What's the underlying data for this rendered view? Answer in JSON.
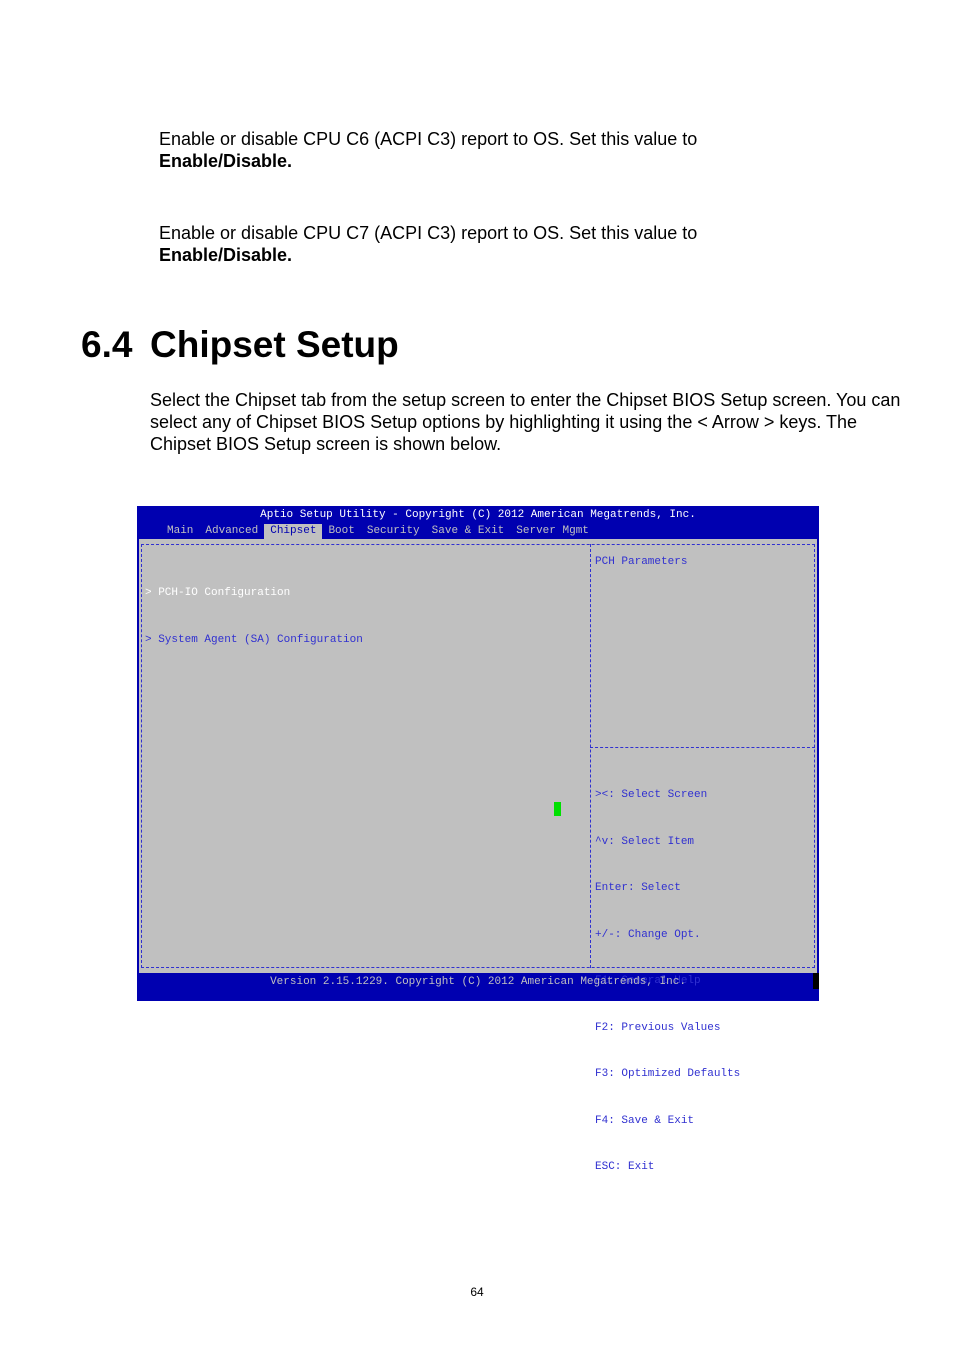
{
  "document": {
    "paragraph_c6": {
      "text": "Enable or disable CPU C6 (ACPI C3) report to OS. Set this value to",
      "bold": "Enable/Disable."
    },
    "paragraph_c7": {
      "text": "Enable or disable CPU C7 (ACPI C3) report to OS. Set this value to",
      "bold": "Enable/Disable."
    },
    "section": {
      "number": "6.4",
      "title": "Chipset Setup"
    },
    "intro": "Select the Chipset tab from the setup screen to enter the Chipset BIOS Setup screen. You can select any of Chipset BIOS Setup options by highlighting it using the < Arrow > keys. The Chipset BIOS Setup screen is shown below.",
    "page_number": "64"
  },
  "bios": {
    "title": "Aptio Setup Utility - Copyright (C) 2012 American Megatrends, Inc.",
    "tabs": [
      {
        "label": "Main",
        "active": false
      },
      {
        "label": "Advanced",
        "active": false
      },
      {
        "label": "Chipset",
        "active": true
      },
      {
        "label": "Boot",
        "active": false
      },
      {
        "label": "Security",
        "active": false
      },
      {
        "label": "Save & Exit",
        "active": false
      },
      {
        "label": "Server Mgmt",
        "active": false
      }
    ],
    "menu_items": [
      {
        "label": "> PCH-IO Configuration",
        "selected": true
      },
      {
        "label": "> System Agent (SA) Configuration",
        "selected": false
      }
    ],
    "help_text": "PCH Parameters",
    "key_help": [
      "><: Select Screen",
      "^v: Select Item",
      "Enter: Select",
      "+/-: Change Opt.",
      "F1: General Help",
      "F2: Previous Values",
      "F3: Optimized Defaults",
      "F4: Save & Exit",
      "ESC: Exit"
    ],
    "footer": "Version 2.15.1229. Copyright (C) 2012 American Megatrends, Inc.",
    "colors": {
      "background": "#0000b0",
      "panel": "#c0c0c0",
      "text_blue": "#3030d0",
      "selected_text": "#ffffff",
      "cursor": "#00e000"
    }
  }
}
